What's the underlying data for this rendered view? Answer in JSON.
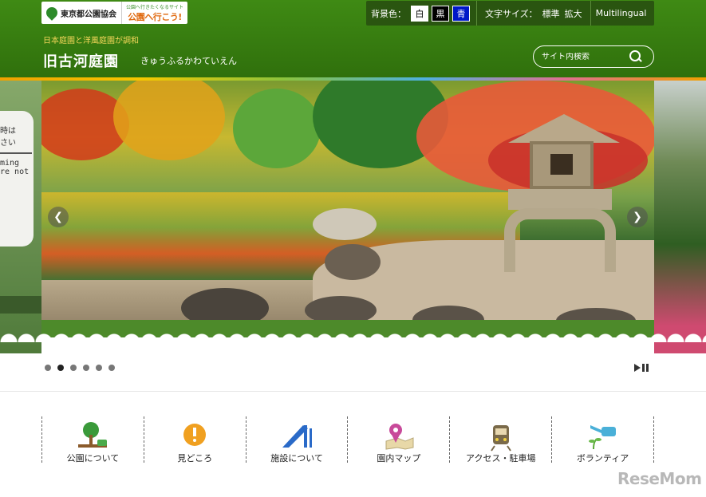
{
  "header": {
    "logo_org": "東京都公園協会",
    "logo_site_sub": "公園へ行きたくなるサイト",
    "logo_site_main": "公園へ行こう!",
    "tagline": "日本庭園と洋風庭園が調和",
    "title": "旧古河庭園",
    "reading": "きゅうふるかわていえん"
  },
  "toolbar": {
    "bg_label": "背景色：",
    "bg_white": "白",
    "bg_black": "黒",
    "bg_blue": "青",
    "font_label": "文字サイズ：",
    "font_standard": "標準",
    "font_large": "拡大",
    "multilingual": "Multilingual"
  },
  "search": {
    "placeholder": "サイト内検索"
  },
  "carousel": {
    "left_notice": [
      "時は",
      "さい",
      "ming",
      "re not"
    ],
    "slide_count": 6,
    "active_slide": 2
  },
  "nav": {
    "items": [
      {
        "label": "公園について",
        "icon": "tree-bench-icon"
      },
      {
        "label": "見どころ",
        "icon": "exclamation-badge-icon"
      },
      {
        "label": "施設について",
        "icon": "slide-icon"
      },
      {
        "label": "園内マップ",
        "icon": "map-pin-icon"
      },
      {
        "label": "アクセス・駐車場",
        "icon": "train-icon"
      },
      {
        "label": "ボランティア",
        "icon": "watering-can-icon"
      }
    ]
  },
  "watermark": "ReseMom",
  "colors": {
    "header_green": "#3f8a14",
    "tagline_yellow": "#f4d65a",
    "toolbar_bg": "#2a5510"
  }
}
